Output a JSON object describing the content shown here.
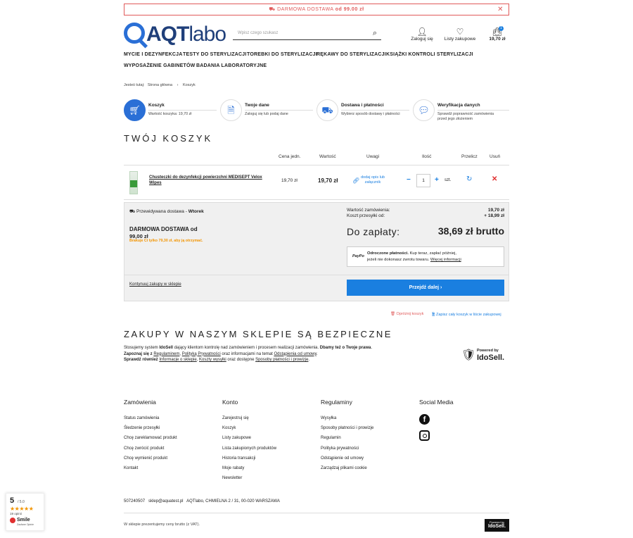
{
  "topbar": {
    "prefix": "DARMOWA DOSTAWA",
    "od": "od",
    "amount": "99.00 zł",
    "truck_icon": "truck-icon",
    "close_icon": "close-icon"
  },
  "header": {
    "logo_aqt": "AQT",
    "logo_labo": "labo",
    "search_placeholder": "Wpisz czego szukasz",
    "login_label": "Zaloguj się",
    "wishlist_label": "Listy zakupowe",
    "cart_total": "19,70 zł",
    "cart_count": "1"
  },
  "nav": [
    "MYCIE I DEZYNFEKCJA",
    "TESTY DO STERYLIZACJI",
    "TOREBKI DO STERYLIZACJI",
    "RĘKAWY DO STERYLIZACJI",
    "KSIĄŻKI KONTROLI STERYLIZACJI",
    "WYPOSAŻENIE GABINETÓW",
    "BADANIA LABORATORYJNE"
  ],
  "breadcrumb": {
    "prefix": "Jesteś tutaj:",
    "home": "Strona główna",
    "sep": "›",
    "current": "Koszyk"
  },
  "steps": [
    {
      "title": "Koszyk",
      "desc": "Wartość koszyka: 19,70 zł",
      "icon": "cart-icon"
    },
    {
      "title": "Twoje dane",
      "desc": "Zaloguj się lub podaj dane",
      "icon": "document-icon"
    },
    {
      "title": "Dostawa i płatności",
      "desc": "Wybierz sposób dostawy i płatności",
      "icon": "truck-icon"
    },
    {
      "title": "Weryfikacja danych",
      "desc1": "Sprawdź poprawność zamówienia",
      "desc2": "przed jego złożeniem",
      "icon": "chat-icon"
    }
  ],
  "cart": {
    "title": "TWÓJ KOSZYK",
    "headers": {
      "price": "Cena jedn.",
      "value": "Wartość",
      "notes": "Uwagi",
      "qty": "Ilość",
      "recalc": "Przelicz",
      "remove": "Usuń"
    },
    "item": {
      "name1": "Chusteczki do dezynfekcji powierzchni MEDISEPT Velox",
      "name2": "Wipes",
      "price": "19,70 zł",
      "value": "19,70 zł",
      "note1": "dodaj opis lub",
      "note2": "załącznik",
      "qty": "1",
      "unit": "szt."
    }
  },
  "summary": {
    "delivery_prefix": "Przewidywana dostawa -",
    "delivery_day": "Wtorek",
    "free_title": "DARMOWA DOSTAWA od",
    "free_amount": "99,00 zł",
    "missing": "Brakuje Ci tylko 79,30 zł, aby ją otrzymać.",
    "order_value_label": "Wartość zamówienia:",
    "order_value": "19,70 zł",
    "shipping_label": "Koszt przesyłki od:",
    "shipping": "+ 18,99 zł",
    "to_pay_label": "Do zapłaty:",
    "to_pay": "38,69 zł brutto",
    "paypo_logo": "PayPo",
    "paypo_bold": "Odroczone płatności.",
    "paypo_text1": " Kup teraz, zapłać później,",
    "paypo_text2": "jeżeli nie dokonasz zwrotu towaru.",
    "paypo_link": "Więcej informacji",
    "continue": "Kontynuuj zakupy w sklepie",
    "next": "Przejdź dalej",
    "clear": "Opróżnij koszyk",
    "save_list": "Zapisz cały koszyk w liście zakupowej"
  },
  "safe": {
    "title": "ZAKUPY W NASZYM SKLEPIE SĄ BEZPIECZNE",
    "l1a": "Stosujemy system ",
    "l1b": "IdoSell",
    "l1c": " dający klientom kontrolę nad zamówieniem i procesem realizacji zamówienia. ",
    "l1d": "Dbamy też o Twoje prawa",
    "l1e": ".",
    "l2a": "Zapoznaj się z ",
    "l2b": "Regulaminem",
    "l2c": ", ",
    "l2d": "Polityką Prywatności",
    "l2e": " oraz informacjami na temat ",
    "l2f": "Odstąpienia od umowy",
    "l2g": ".",
    "l3a": "Sprawdź również ",
    "l3b": "Informacje o sklepie",
    "l3c": ", ",
    "l3d": "Koszty wysyłki",
    "l3e": " oraz dostępne ",
    "l3f": "Sposoby płatności i prowizje",
    "l3g": ".",
    "powered": "Powered by",
    "idosell": "IdoSell."
  },
  "footer": {
    "cols": [
      {
        "title": "Zamówienia",
        "items": [
          "Status zamówienia",
          "Śledzenie przesyłki",
          "Chcę zareklamować produkt",
          "Chcę zwrócić produkt",
          "Chcę wymienić produkt",
          "Kontakt"
        ]
      },
      {
        "title": "Konto",
        "items": [
          "Zarejestruj się",
          "Koszyk",
          "Listy zakupowe",
          "Lista zakupionych produktów",
          "Historia transakcji",
          "Moje rabaty",
          "Newsletter"
        ]
      },
      {
        "title": "Regulaminy",
        "items": [
          "Wysyłka",
          "Sposoby płatności i prowizje",
          "Regulamin",
          "Polityka prywatności",
          "Odstąpienie od umowy",
          "Zarządzaj plikami cookie"
        ]
      },
      {
        "title": "Social Media",
        "items": []
      }
    ],
    "contact": "507240507   sklep@aquatest.pl   AQTlabo, CHMIELNA 2 / 31, 00-020 WARSZAWA",
    "vat": "W sklepie prezentujemy ceny brutto (z VAT).",
    "powered": "Powered by",
    "idosell": "IdoSell."
  },
  "rating": {
    "score": "5",
    "out_of": "/ 5.0",
    "stars": "★★★★★",
    "count": "19 opinii",
    "brand": "Smile",
    "brand_sub": "Zaufane Opinie"
  },
  "colors": {
    "accent": "#1a7fe0",
    "danger": "#e05a5a",
    "orange": "#f29400",
    "navy": "#1f3f7a"
  }
}
